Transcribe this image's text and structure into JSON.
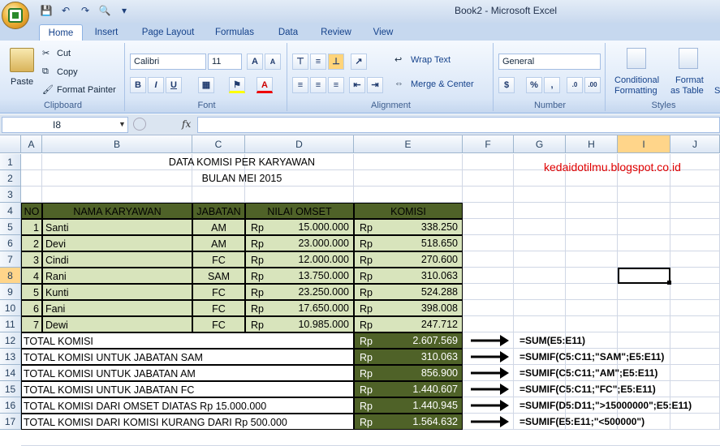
{
  "window": {
    "title": "Book2 - Microsoft Excel"
  },
  "tabs": [
    "Home",
    "Insert",
    "Page Layout",
    "Formulas",
    "Data",
    "Review",
    "View"
  ],
  "ribbon": {
    "clipboard": {
      "label": "Clipboard",
      "paste": "Paste",
      "cut": "Cut",
      "copy": "Copy",
      "format_painter": "Format Painter"
    },
    "font": {
      "label": "Font",
      "family": "Calibri",
      "size": "11"
    },
    "alignment": {
      "label": "Alignment",
      "wrap_text": "Wrap Text",
      "merge_center": "Merge & Center"
    },
    "number": {
      "label": "Number",
      "format": "General"
    },
    "styles": {
      "label": "Styles",
      "conditional": "Conditional",
      "formatting": "Formatting",
      "format_as": "Format",
      "as_table": "as Table",
      "cell_styles": "St"
    }
  },
  "formula_bar": {
    "name_box": "I8",
    "fx": "fx",
    "value": ""
  },
  "columns": [
    "A",
    "B",
    "C",
    "D",
    "E",
    "F",
    "G",
    "H",
    "I",
    "J"
  ],
  "rows": [
    "1",
    "2",
    "3",
    "4",
    "5",
    "6",
    "7",
    "8",
    "9",
    "10",
    "11",
    "12",
    "13",
    "14",
    "15",
    "16",
    "17"
  ],
  "sheet": {
    "title1": "DATA KOMISI PER KARYAWAN",
    "title2": "BULAN MEI 2015",
    "watermark": "kedaidotilmu.blogspot.co.id",
    "headers": {
      "no": "NO",
      "nama": "NAMA KARYAWAN",
      "jabatan": "JABATAN",
      "omset": "NILAI OMSET",
      "komisi": "KOMISI"
    },
    "employees": [
      {
        "no": "1",
        "nama": "Santi",
        "jabatan": "AM",
        "rp": "Rp",
        "omset": "15.000.000",
        "rp2": "Rp",
        "komisi": "338.250"
      },
      {
        "no": "2",
        "nama": "Devi",
        "jabatan": "AM",
        "rp": "Rp",
        "omset": "23.000.000",
        "rp2": "Rp",
        "komisi": "518.650"
      },
      {
        "no": "3",
        "nama": "Cindi",
        "jabatan": "FC",
        "rp": "Rp",
        "omset": "12.000.000",
        "rp2": "Rp",
        "komisi": "270.600"
      },
      {
        "no": "4",
        "nama": "Rani",
        "jabatan": "SAM",
        "rp": "Rp",
        "omset": "13.750.000",
        "rp2": "Rp",
        "komisi": "310.063"
      },
      {
        "no": "5",
        "nama": "Kunti",
        "jabatan": "FC",
        "rp": "Rp",
        "omset": "23.250.000",
        "rp2": "Rp",
        "komisi": "524.288"
      },
      {
        "no": "6",
        "nama": "Fani",
        "jabatan": "FC",
        "rp": "Rp",
        "omset": "17.650.000",
        "rp2": "Rp",
        "komisi": "398.008"
      },
      {
        "no": "7",
        "nama": "Dewi",
        "jabatan": "FC",
        "rp": "Rp",
        "omset": "10.985.000",
        "rp2": "Rp",
        "komisi": "247.712"
      }
    ],
    "totals": [
      {
        "label": "TOTAL KOMISI",
        "rp": "Rp",
        "value": "2.607.569",
        "formula": "=SUM(E5:E11)"
      },
      {
        "label": "TOTAL KOMISI UNTUK JABATAN SAM",
        "rp": "Rp",
        "value": "310.063",
        "formula": "=SUMIF(C5:C11;\"SAM\";E5:E11)"
      },
      {
        "label": "TOTAL KOMISI UNTUK JABATAN AM",
        "rp": "Rp",
        "value": "856.900",
        "formula": "=SUMIF(C5:C11;\"AM\";E5:E11)"
      },
      {
        "label": "TOTAL KOMISI UNTUK JABATAN FC",
        "rp": "Rp",
        "value": "1.440.607",
        "formula": "=SUMIF(C5:C11;\"FC\";E5:E11)"
      },
      {
        "label": "TOTAL KOMISI DARI OMSET DIATAS Rp 15.000.000",
        "rp": "Rp",
        "value": "1.440.945",
        "formula": "=SUMIF(D5:D11;\">15000000\";E5:E11)"
      },
      {
        "label": "TOTAL KOMISI DARI KOMISI KURANG DARI Rp 500.000",
        "rp": "Rp",
        "value": "1.564.632",
        "formula": "=SUMIF(E5:E11;\"<500000\")"
      }
    ]
  },
  "colors": {
    "header_green": "#4f6228",
    "body_green": "#d8e4bc",
    "total_green": "#4f6228",
    "watermark": "#e00000"
  }
}
